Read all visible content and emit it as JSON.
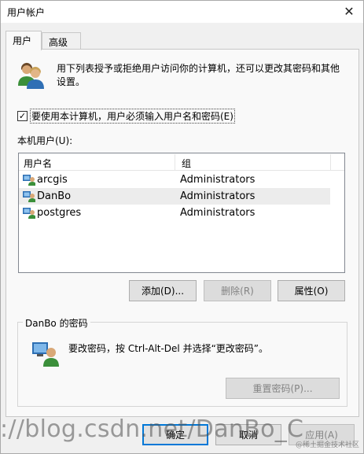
{
  "window": {
    "title": "用户帐户"
  },
  "tabs": [
    {
      "label": "用户"
    },
    {
      "label": "高级"
    }
  ],
  "intro": {
    "text": "用下列表授予或拒绝用户访问你的计算机，还可以更改其密码和其他设置。"
  },
  "require_login": {
    "checked": true,
    "label": "要使用本计算机，用户必须输入用户名和密码(E)"
  },
  "users_section": {
    "label": "本机用户(U):"
  },
  "user_list": {
    "columns": [
      "用户名",
      "组"
    ],
    "rows": [
      {
        "name": "arcgis",
        "group": "Administrators"
      },
      {
        "name": "DanBo",
        "group": "Administrators"
      },
      {
        "name": "postgres",
        "group": "Administrators"
      }
    ],
    "selected": "DanBo"
  },
  "list_buttons": {
    "add": "添加(D)...",
    "remove": "删除(R)",
    "properties": "属性(O)"
  },
  "password_group": {
    "title": "DanBo 的密码",
    "text": "要改密码，按 Ctrl-Alt-Del 并选择“更改密码”。",
    "reset_button": "重置密码(P)..."
  },
  "dialog_buttons": {
    "ok": "确定",
    "cancel": "取消",
    "apply": "应用(A)"
  },
  "watermark": {
    "text": "://blog.csdn.net/DanBo_C",
    "credit": "@稀土掘金技术社区"
  },
  "colors": {
    "accent": "#0078d7",
    "selected_row": "#ececec",
    "tab_page": "#f9f9f9"
  }
}
